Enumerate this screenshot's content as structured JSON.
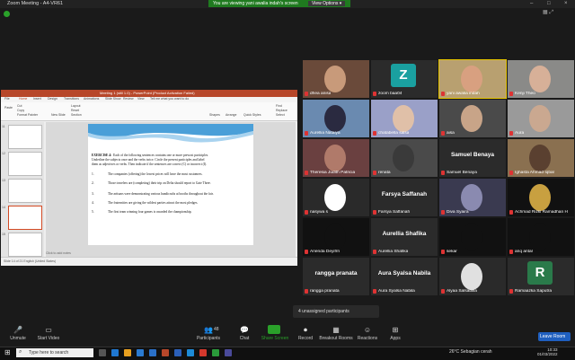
{
  "window": {
    "title": "Zoom Meeting - A4-VR61",
    "viewing_banner": "You are viewing yani awalia indah's screen",
    "view_options": "View Options ▾"
  },
  "ppt": {
    "title": "Meeting 1 (still 1.0) - PowerPoint (Product Activation Failed)",
    "tabs": [
      "File",
      "Home",
      "Insert",
      "Design",
      "Transitions",
      "Animations",
      "Slide Show",
      "Review",
      "View",
      "Tell me what you want to do"
    ],
    "ribbon_labels": [
      "Paste",
      "Cut",
      "Copy",
      "Format Painter",
      "New Slide",
      "Layout",
      "Reset",
      "Section",
      "Shapes",
      "Arrange",
      "Quick Styles",
      "Find",
      "Replace",
      "Select"
    ],
    "slide_numbers": [
      "11",
      "12",
      "13",
      "14",
      "15"
    ],
    "exercise_title": "EXERCISE 4:",
    "exercise_lines": [
      "Each of the following sentences contains one or more prewost participles.",
      "Underline the subjects once and the verbs twice. Circle the present participles and label",
      "them as adjectives or verbs. Then indicate if the sentences are correct (C) or incorrect (I)."
    ],
    "sentences": [
      {
        "num": "1.",
        "text": "The companies (offering) the lowest prices will have the most customers."
      },
      {
        "num": "2.",
        "text": "Those travelers are (completing) their trip on Delta should report to Gate Three."
      },
      {
        "num": "3.",
        "text": "The artisans were demonstrating various handicrafts at booths throughout the fair."
      },
      {
        "num": "4.",
        "text": "The fraternities are giving the wildest parties attract the most pledges."
      },
      {
        "num": "5.",
        "text": "The first team winning four games is awarded the championship."
      }
    ],
    "notes": "Click to add notes",
    "status": "Slide 14 of 21   English (United States)"
  },
  "participants": [
    {
      "name": "dhea anisa",
      "type": "video",
      "skin": "#c89a7a",
      "bg": "#6a4a3a"
    },
    {
      "name": "zoom baa04",
      "type": "avatar",
      "letter": "Z",
      "color": "#1aa0a0"
    },
    {
      "name": "yani awalia indah",
      "type": "video",
      "skin": "#d8a080",
      "bg": "#b8a070",
      "highlight": true
    },
    {
      "name": "Kenji Theo",
      "type": "video",
      "skin": "#d7b098",
      "bg": "#8a8a88"
    },
    {
      "name": "Aurellia Nataiya",
      "type": "video",
      "skin": "#2a2a40",
      "bg": "#6a8ab0"
    },
    {
      "name": "chatabella salsa",
      "type": "video",
      "skin": "#e0c0a8",
      "bg": "#9aa0c8"
    },
    {
      "name": "aisa",
      "type": "video",
      "skin": "#c8a488",
      "bg": "#4a4a4a"
    },
    {
      "name": "Aura",
      "type": "video",
      "skin": "#caa890",
      "bg": "#9a9a9a"
    },
    {
      "name": "Theresia Judith Patricia",
      "type": "video",
      "skin": "#b07a6a",
      "bg": "#6a4040"
    },
    {
      "name": "renata",
      "type": "video",
      "skin": "#3a3a3a",
      "bg": "#4a4a4a"
    },
    {
      "name": "Samuel Benaya",
      "type": "name",
      "label": "Samuel Benaya"
    },
    {
      "name": "Ighasta Ahmad Iqbal",
      "type": "video",
      "skin": "#5a4030",
      "bg": "#8a7050"
    },
    {
      "name": "nasywa s",
      "type": "video",
      "skin": "#ffffff",
      "bg": "#2a2a2a"
    },
    {
      "name": "Farsya Saffanah",
      "type": "name",
      "label": "Farsya Saffanah"
    },
    {
      "name": "Diva Syaira",
      "type": "video",
      "skin": "#8a8ab0",
      "bg": "#3a3a50"
    },
    {
      "name": "Achmad Rizki Ramadhan H",
      "type": "video",
      "skin": "#c8a040",
      "bg": "#111111"
    },
    {
      "name": "Arienda Deyifrri",
      "type": "video",
      "skin": "#111111",
      "bg": "#111111"
    },
    {
      "name": "Aurellia Shafika",
      "type": "name",
      "label": "Aurellia Shafika"
    },
    {
      "name": "sekar",
      "type": "video",
      "skin": "#111111",
      "bg": "#111111"
    },
    {
      "name": "ariq antar",
      "type": "video",
      "skin": "#111111",
      "bg": "#111111"
    },
    {
      "name": "rangga pranata",
      "type": "name",
      "label": "rangga pranata"
    },
    {
      "name": "Aura Syalsa Nabila",
      "type": "name",
      "label": "Aura Syalsa Nabila"
    },
    {
      "name": "Alyaa Salsabilla",
      "type": "video",
      "skin": "#e0e0e0",
      "bg": "#2a2a2a"
    },
    {
      "name": "Ramaazka Saputra",
      "type": "avatar",
      "letter": "R",
      "color": "#2a7a4a"
    }
  ],
  "unassigned": "4 unassigned participants",
  "toolbar": {
    "unmute": "Unmute",
    "start_video": "Start Video",
    "participants": "Participants",
    "participants_count": "48",
    "chat": "Chat",
    "share_screen": "Share Screen",
    "record": "Record",
    "breakout": "Breakout Rooms",
    "reactions": "Reactions",
    "apps": "Apps",
    "leave": "Leave Room"
  },
  "taskbar": {
    "search_placeholder": "Type here to search",
    "weather": "26°C  Sebagian cerah",
    "time": "10:33",
    "date": "01/03/2022"
  }
}
